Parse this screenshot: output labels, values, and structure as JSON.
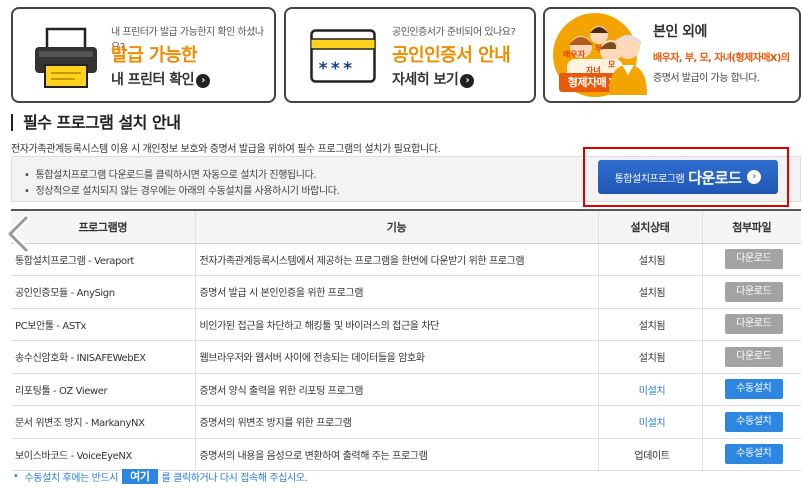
{
  "cards": [
    {
      "small": "내 프린터가 발급 가능한지 확인 하셨나요?",
      "big": "발급 가능한",
      "link": "내 프린터 확인",
      "icon": "printer-icon"
    },
    {
      "small": "공인인증서가 준비되어 있나요?",
      "big": "공인인증서 안내",
      "link": "자세히 보기",
      "icon": "certificate-card-icon",
      "card_text": "***"
    },
    {
      "line1": "본인 외에",
      "line2": "배우자, 부, 모, 자녀(형제자매X)의",
      "line3": "증명서 발급이 가능 합니다.",
      "badge": "형제자매",
      "badge_x": "X",
      "family_labels": [
        "배우자",
        "부",
        "모",
        "자녀"
      ],
      "icon": "family-icon"
    }
  ],
  "section": {
    "title": "필수 프로그램 설치 안내",
    "description": "전자가족관계등록시스템 이용 시 개인정보 보호와 증명서 발급을 위하여 필수 프로그램의 설치가 필요합니다."
  },
  "notice": {
    "lines": [
      "통합설치프로그램 다운로드를 클릭하시면 자동으로 설치가 진행됩니다.",
      "정상적으로 설치되지 않는 경우에는 아래의 수동설치를 사용하시기 바랍니다."
    ]
  },
  "download_button": {
    "small": "통합설치프로그램",
    "big": "다운로드"
  },
  "table": {
    "headers": [
      "프로그램명",
      "기능",
      "설치상태",
      "첨부파일"
    ],
    "rows": [
      {
        "name": "통합설치프로그램 - Veraport",
        "desc": "전자가족관계등록시스템에서 제공하는 프로그램을 한번에 다운받기 위한 프로그램",
        "status": "설치됨",
        "button": "다운로드",
        "installed": true
      },
      {
        "name": "공인인증모듈 - AnySign",
        "desc": "증명서 발급 시 본인인증을 위한 프로그램",
        "status": "설치됨",
        "button": "다운로드",
        "installed": true
      },
      {
        "name": "PC보안툴 - ASTx",
        "desc": "비인가된 접근을 차단하고 해킹툴 및 바이러스의 접근을 차단",
        "status": "설치됨",
        "button": "다운로드",
        "installed": true
      },
      {
        "name": "송수신암호화 - INISAFEWebEX",
        "desc": "웹브라우저와 웹서버 사이에 전송되는 데이터들을 암호화",
        "status": "설치됨",
        "button": "다운로드",
        "installed": true
      },
      {
        "name": "리포팅툴 - OZ Viewer",
        "desc": "증명서 양식 출력을 위한 리포팅 프로그램",
        "status": "미설치",
        "button": "수동설치",
        "installed": false
      },
      {
        "name": "문서 위변조 방지 - MarkanyNX",
        "desc": "증명서의 위변조 방지를 위한 프로그램",
        "status": "미설치",
        "button": "수동설치",
        "installed": false
      },
      {
        "name": "보이스바코드 - VoiceEyeNX",
        "desc": "증명서의 내용을 음성으로 변환하여 출력해 주는 프로그램",
        "status": "업데이트",
        "button": "수동설치",
        "installed": false
      }
    ]
  },
  "footer": {
    "before": "수동설치 후에는 반드시",
    "here": "여기",
    "after": "를 클릭하거나 다시 접속해 주십시오."
  },
  "colors": {
    "accent_orange": "#f08c00",
    "primary_blue": "#1f56b3",
    "link_blue": "#2b7bd6",
    "highlight_red": "#e00000"
  }
}
